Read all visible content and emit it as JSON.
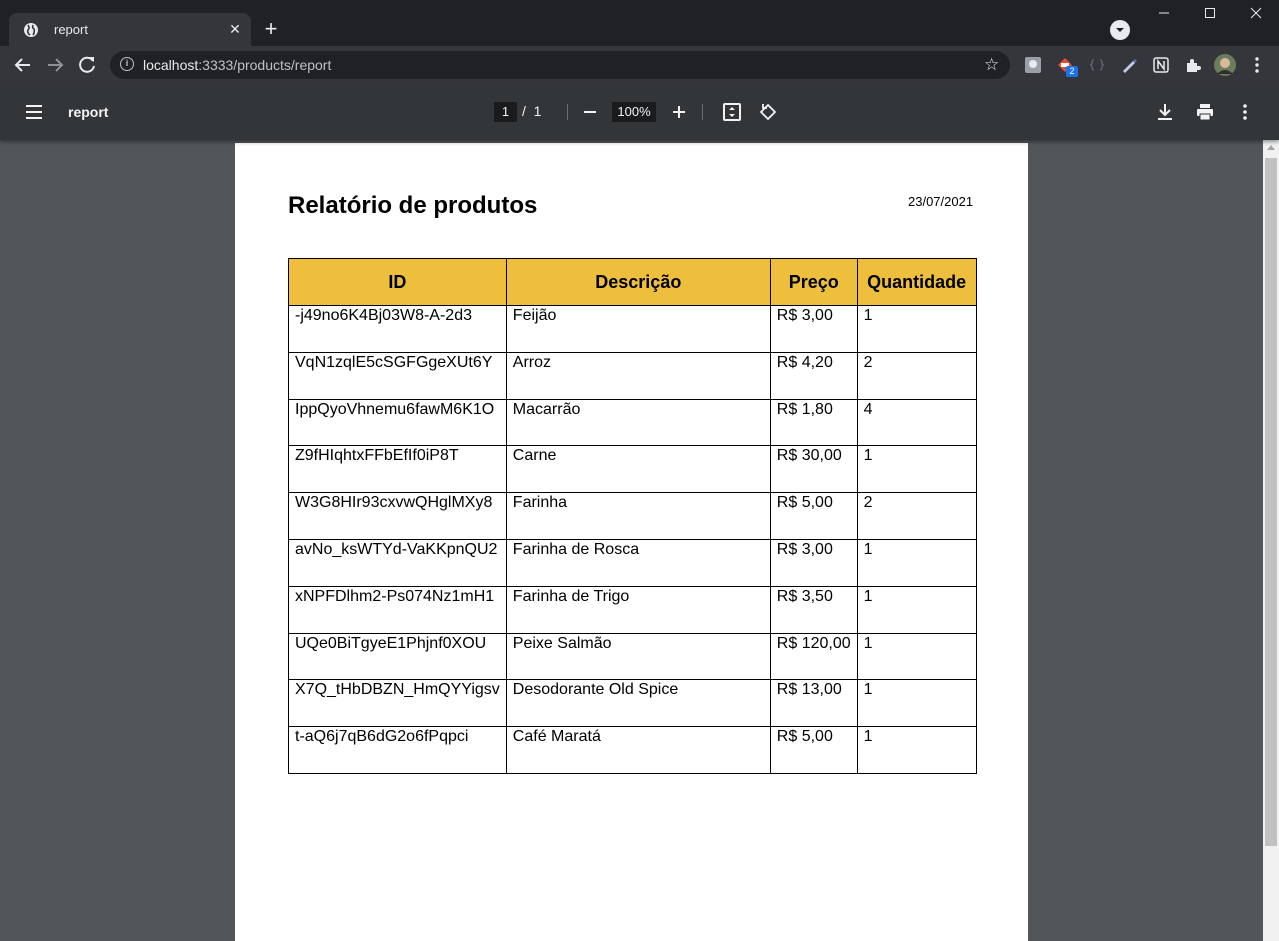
{
  "browser": {
    "tab_title": "report",
    "url_host": "localhost",
    "url_rest": ":3333/products/report",
    "extension_badge": "2"
  },
  "pdf_toolbar": {
    "title": "report",
    "current_page": "1",
    "page_separator": "/",
    "total_pages": "1",
    "zoom": "100%"
  },
  "report": {
    "title": "Relatório de produtos",
    "date": "23/07/2021",
    "columns": [
      "ID",
      "Descrição",
      "Preço",
      "Quantidade"
    ],
    "rows": [
      {
        "id": "-j49no6K4Bj03W8-A-2d3",
        "descricao": "Feijão",
        "preco": "R$ 3,00",
        "quantidade": "1"
      },
      {
        "id": "VqN1zqlE5cSGFGgeXUt6Y",
        "descricao": "Arroz",
        "preco": "R$ 4,20",
        "quantidade": "2"
      },
      {
        "id": "IppQyoVhnemu6fawM6K1O",
        "descricao": "Macarrão",
        "preco": "R$ 1,80",
        "quantidade": "4"
      },
      {
        "id": "Z9fHIqhtxFFbEfIf0iP8T",
        "descricao": "Carne",
        "preco": "R$ 30,00",
        "quantidade": "1"
      },
      {
        "id": "W3G8HIr93cxvwQHglMXy8",
        "descricao": "Farinha",
        "preco": "R$ 5,00",
        "quantidade": "2"
      },
      {
        "id": "avNo_ksWTYd-VaKKpnQU2",
        "descricao": "Farinha de Rosca",
        "preco": "R$ 3,00",
        "quantidade": "1"
      },
      {
        "id": "xNPFDlhm2-Ps074Nz1mH1",
        "descricao": "Farinha de Trigo",
        "preco": "R$ 3,50",
        "quantidade": "1"
      },
      {
        "id": "UQe0BiTgyeE1Phjnf0XOU",
        "descricao": "Peixe Salmão",
        "preco": "R$ 120,00",
        "quantidade": "1"
      },
      {
        "id": "X7Q_tHbDBZN_HmQYYigsv",
        "descricao": "Desodorante Old Spice",
        "preco": "R$ 13,00",
        "quantidade": "1"
      },
      {
        "id": "t-aQ6j7qB6dG2o6fPqpci",
        "descricao": "Café Maratá",
        "preco": "R$ 5,00",
        "quantidade": "1"
      }
    ]
  },
  "colors": {
    "header_bg": "#eebf3d",
    "viewer_bg": "#525659",
    "pdf_toolbar_bg": "#323639"
  }
}
